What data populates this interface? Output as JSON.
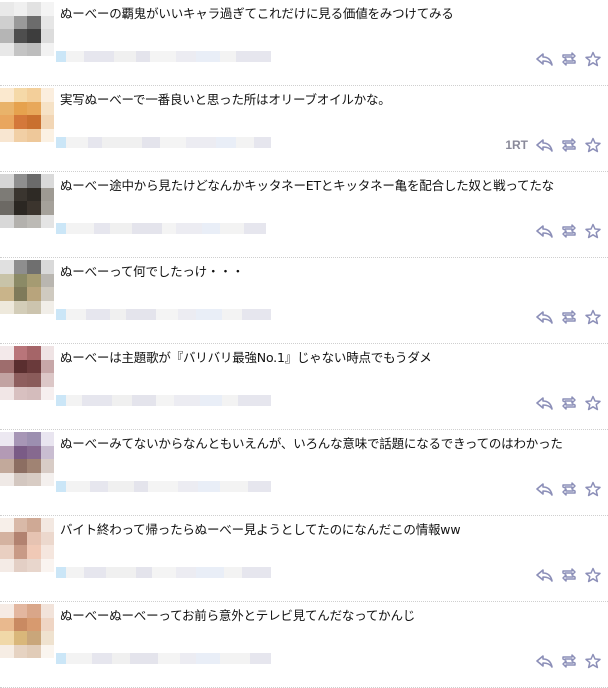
{
  "tweets": [
    {
      "text": "ぬーべーの覇鬼がいいキャラ過ぎてこれだけに見る価値をみつけてみる",
      "rt_count": "",
      "avatar": [
        "#e9e9e9",
        "#f0f0f0",
        "#e2e2e2",
        "#f4f4f4",
        "#cfcfcf",
        "#9a9a9a",
        "#6c6c6c",
        "#e6e6e6",
        "#b5b5b5",
        "#4e4e4e",
        "#3d3d3d",
        "#dcdcdc",
        "#e8e8e8",
        "#c4c4c4",
        "#bdbdbd",
        "#f2f2f2"
      ]
    },
    {
      "text": "実写ぬーべーで一番良いと思った所はオリーブオイルかな。",
      "rt_count": "1RT",
      "avatar": [
        "#fbe9cf",
        "#f5d9a8",
        "#f3cf9a",
        "#fbeede",
        "#e9b36a",
        "#e6a24e",
        "#e8a85a",
        "#f6e2c6",
        "#e9a65e",
        "#d4783a",
        "#c9702f",
        "#f2d6b5",
        "#f8e6d1",
        "#f1cfa5",
        "#eec89a",
        "#fbf1e3"
      ]
    },
    {
      "text": "ぬーべー途中から見たけどなんかキッタネーETとキッタネー亀を配合した奴と戦ってたな",
      "rt_count": "",
      "avatar": [
        "#d6d6d6",
        "#8f8f8f",
        "#6b6b6b",
        "#dadada",
        "#7d7b76",
        "#3a352f",
        "#2e2a25",
        "#9e9a93",
        "#6c6964",
        "#2b2722",
        "#3b342d",
        "#a5a19a",
        "#d8d8d8",
        "#b3b1ad",
        "#bcbab5",
        "#e4e4e4"
      ]
    },
    {
      "text": "ぬーべーって何でしたっけ・・・",
      "rt_count": "",
      "avatar": [
        "#e0e0e0",
        "#8e8e8e",
        "#6f6f6f",
        "#d9d9d9",
        "#c8c3a8",
        "#8b8a66",
        "#a59b72",
        "#b9b6b0",
        "#c9b48a",
        "#7f7a5a",
        "#b8a47c",
        "#cfcac0",
        "#eee9dc",
        "#d3cdb8",
        "#ccc4ae",
        "#f1eee8"
      ]
    },
    {
      "text": "ぬーべーは主題歌が『バリバリ最強No.1』じゃない時点でもうダメ",
      "rt_count": "",
      "avatar": [
        "#f3e9ea",
        "#b9757a",
        "#a56568",
        "#efe3e4",
        "#9e6d6d",
        "#5a2e2f",
        "#6a3a3b",
        "#c7a7a8",
        "#c2a3a2",
        "#8e5e5e",
        "#8a5b5a",
        "#dcc7c7",
        "#f1e6e6",
        "#d8c0c0",
        "#d4bcbc",
        "#f6efef"
      ]
    },
    {
      "text": "ぬーべーみてないからなんともいえんが、いろんな意味で話題になるできってのはわかった",
      "rt_count": "",
      "avatar": [
        "#ece8f1",
        "#a796b6",
        "#9c8fb0",
        "#e9e5f0",
        "#b39ab5",
        "#7a5b86",
        "#86698f",
        "#c9bdd1",
        "#c2a99b",
        "#8c6e62",
        "#a08373",
        "#d8ccc6",
        "#efe9e6",
        "#d3c7c0",
        "#d8ccc4",
        "#f4f0ee"
      ]
    },
    {
      "text": "バイト終わって帰ったらぬーべー見ようとしてたのになんだこの情報ww",
      "rt_count": "",
      "avatar": [
        "#f7efe9",
        "#d9b9a8",
        "#cfa995",
        "#f3e8e1",
        "#d4b2a0",
        "#b28270",
        "#e6c3b2",
        "#ecd8cd",
        "#e9cfc1",
        "#c89a86",
        "#f0c9b6",
        "#f5e6de",
        "#f4ebe6",
        "#e3cfc5",
        "#e8d6cc",
        "#faf4f0"
      ]
    },
    {
      "text": "ぬーべーぬーべーってお前ら意外とテレビ見てんだなってかんじ",
      "rt_count": "",
      "avatar": [
        "#f6ebe4",
        "#e3b7a0",
        "#d9a689",
        "#f2e3da",
        "#e9b98e",
        "#c98a62",
        "#d79a6f",
        "#efd5c4",
        "#f0d8a8",
        "#d9b77a",
        "#c9a67a",
        "#efe2cf",
        "#f6ede4",
        "#e6d3c2",
        "#e1ccb8",
        "#faf5ef"
      ]
    }
  ],
  "meta_colors": [
    "#cbe6f7",
    "#e9eef7",
    "#f3f3f3",
    "#e6e6ee",
    "#f0f0f0",
    "#e4e4ec",
    "#f4f4f4",
    "#ececf2"
  ],
  "icons": {
    "reply": "reply-icon",
    "retweet": "retweet-icon",
    "favorite": "star-icon"
  },
  "accent": "#8c8fb8"
}
